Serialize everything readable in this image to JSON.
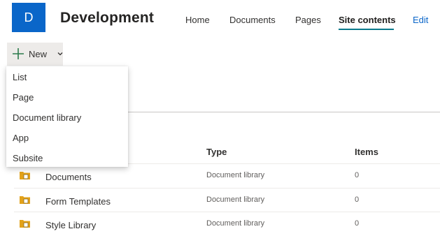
{
  "header": {
    "logo_letter": "D",
    "site_title": "Development",
    "nav": [
      {
        "label": "Home"
      },
      {
        "label": "Documents"
      },
      {
        "label": "Pages"
      },
      {
        "label": "Site contents",
        "active": true
      },
      {
        "label": "Edit"
      }
    ]
  },
  "command_bar": {
    "new_label": "New",
    "new_icon": "plus-icon",
    "chevron_icon": "chevron-down-icon"
  },
  "new_menu": {
    "items": [
      {
        "label": "List"
      },
      {
        "label": "Page"
      },
      {
        "label": "Document library"
      },
      {
        "label": "App"
      },
      {
        "label": "Subsite"
      }
    ]
  },
  "contents_table": {
    "columns": {
      "type": "Type",
      "items": "Items"
    },
    "rows": [
      {
        "icon": "document-library-icon",
        "name": "Documents",
        "type": "Document library",
        "items": "0"
      },
      {
        "icon": "document-library-icon",
        "name": "Form Templates",
        "type": "Document library",
        "items": "0"
      },
      {
        "icon": "document-library-icon",
        "name": "Style Library",
        "type": "Document library",
        "items": "0"
      }
    ]
  },
  "colors": {
    "logo_bg": "#0a66c9",
    "active_underline": "#0a7a8c",
    "plus_icon": "#2b7a4b",
    "library_icon": "#e3a21a"
  }
}
